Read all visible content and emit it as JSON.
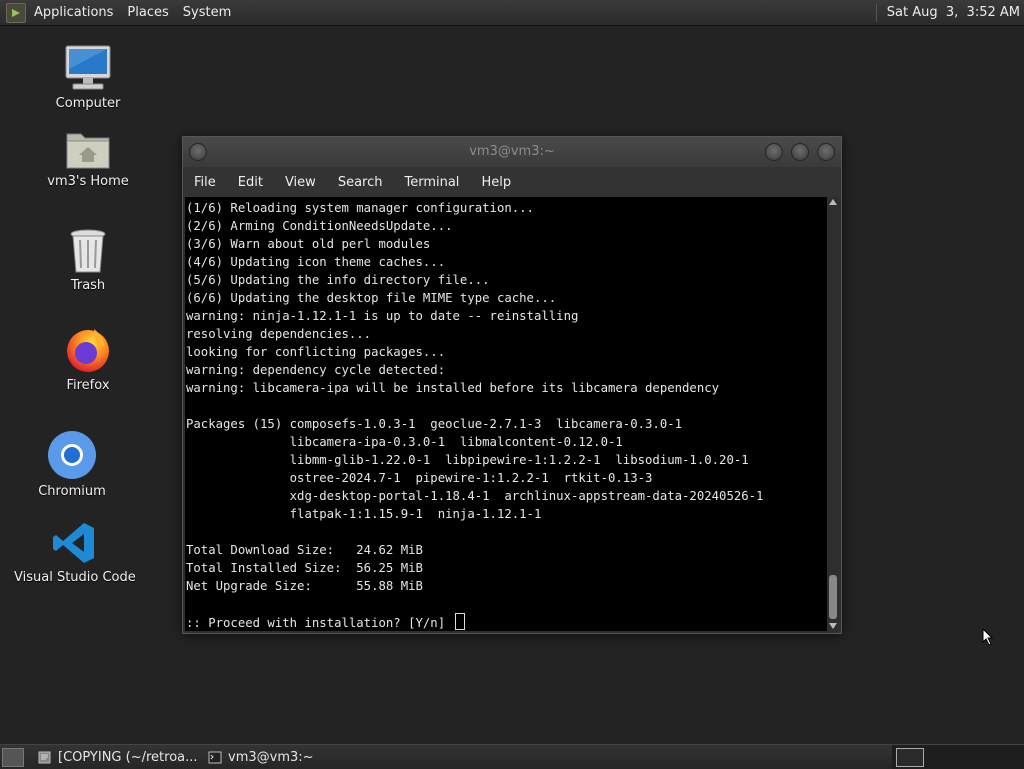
{
  "top_panel": {
    "menus": [
      "Applications",
      "Places",
      "System"
    ],
    "clock": "Sat Aug  3,  3:52 AM"
  },
  "desktop_icons": [
    {
      "label": "Computer",
      "icon": "computer-icon"
    },
    {
      "label": "vm3's Home",
      "icon": "home-folder-icon"
    },
    {
      "label": "Trash",
      "icon": "trash-icon"
    },
    {
      "label": "Firefox",
      "icon": "firefox-icon"
    },
    {
      "label": "Chromium",
      "icon": "chromium-icon"
    },
    {
      "label": "Visual Studio Code",
      "icon": "vscode-icon"
    }
  ],
  "terminal": {
    "title": "vm3@vm3:~",
    "menu": [
      "File",
      "Edit",
      "View",
      "Search",
      "Terminal",
      "Help"
    ],
    "lines": [
      "(1/6) Reloading system manager configuration...",
      "(2/6) Arming ConditionNeedsUpdate...",
      "(3/6) Warn about old perl modules",
      "(4/6) Updating icon theme caches...",
      "(5/6) Updating the info directory file...",
      "(6/6) Updating the desktop file MIME type cache...",
      "warning: ninja-1.12.1-1 is up to date -- reinstalling",
      "resolving dependencies...",
      "looking for conflicting packages...",
      "warning: dependency cycle detected:",
      "warning: libcamera-ipa will be installed before its libcamera dependency",
      "",
      "Packages (15) composefs-1.0.3-1  geoclue-2.7.1-3  libcamera-0.3.0-1",
      "              libcamera-ipa-0.3.0-1  libmalcontent-0.12.0-1",
      "              libmm-glib-1.22.0-1  libpipewire-1:1.2.2-1  libsodium-1.0.20-1",
      "              ostree-2024.7-1  pipewire-1:1.2.2-1  rtkit-0.13-3",
      "              xdg-desktop-portal-1.18.4-1  archlinux-appstream-data-20240526-1",
      "              flatpak-1:1.15.9-1  ninja-1.12.1-1",
      "",
      "Total Download Size:   24.62 MiB",
      "Total Installed Size:  56.25 MiB",
      "Net Upgrade Size:      55.88 MiB",
      ""
    ],
    "prompt": ":: Proceed with installation? [Y/n] "
  },
  "taskbar": {
    "tasks": [
      {
        "label": "[COPYING (~/retroa...",
        "icon": "text-editor-icon"
      },
      {
        "label": "vm3@vm3:~",
        "icon": "terminal-icon"
      }
    ]
  },
  "colors": {
    "desktop_bg": "#232323",
    "terminal_bg": "#000000",
    "terminal_fg": "#e6e6e6"
  }
}
